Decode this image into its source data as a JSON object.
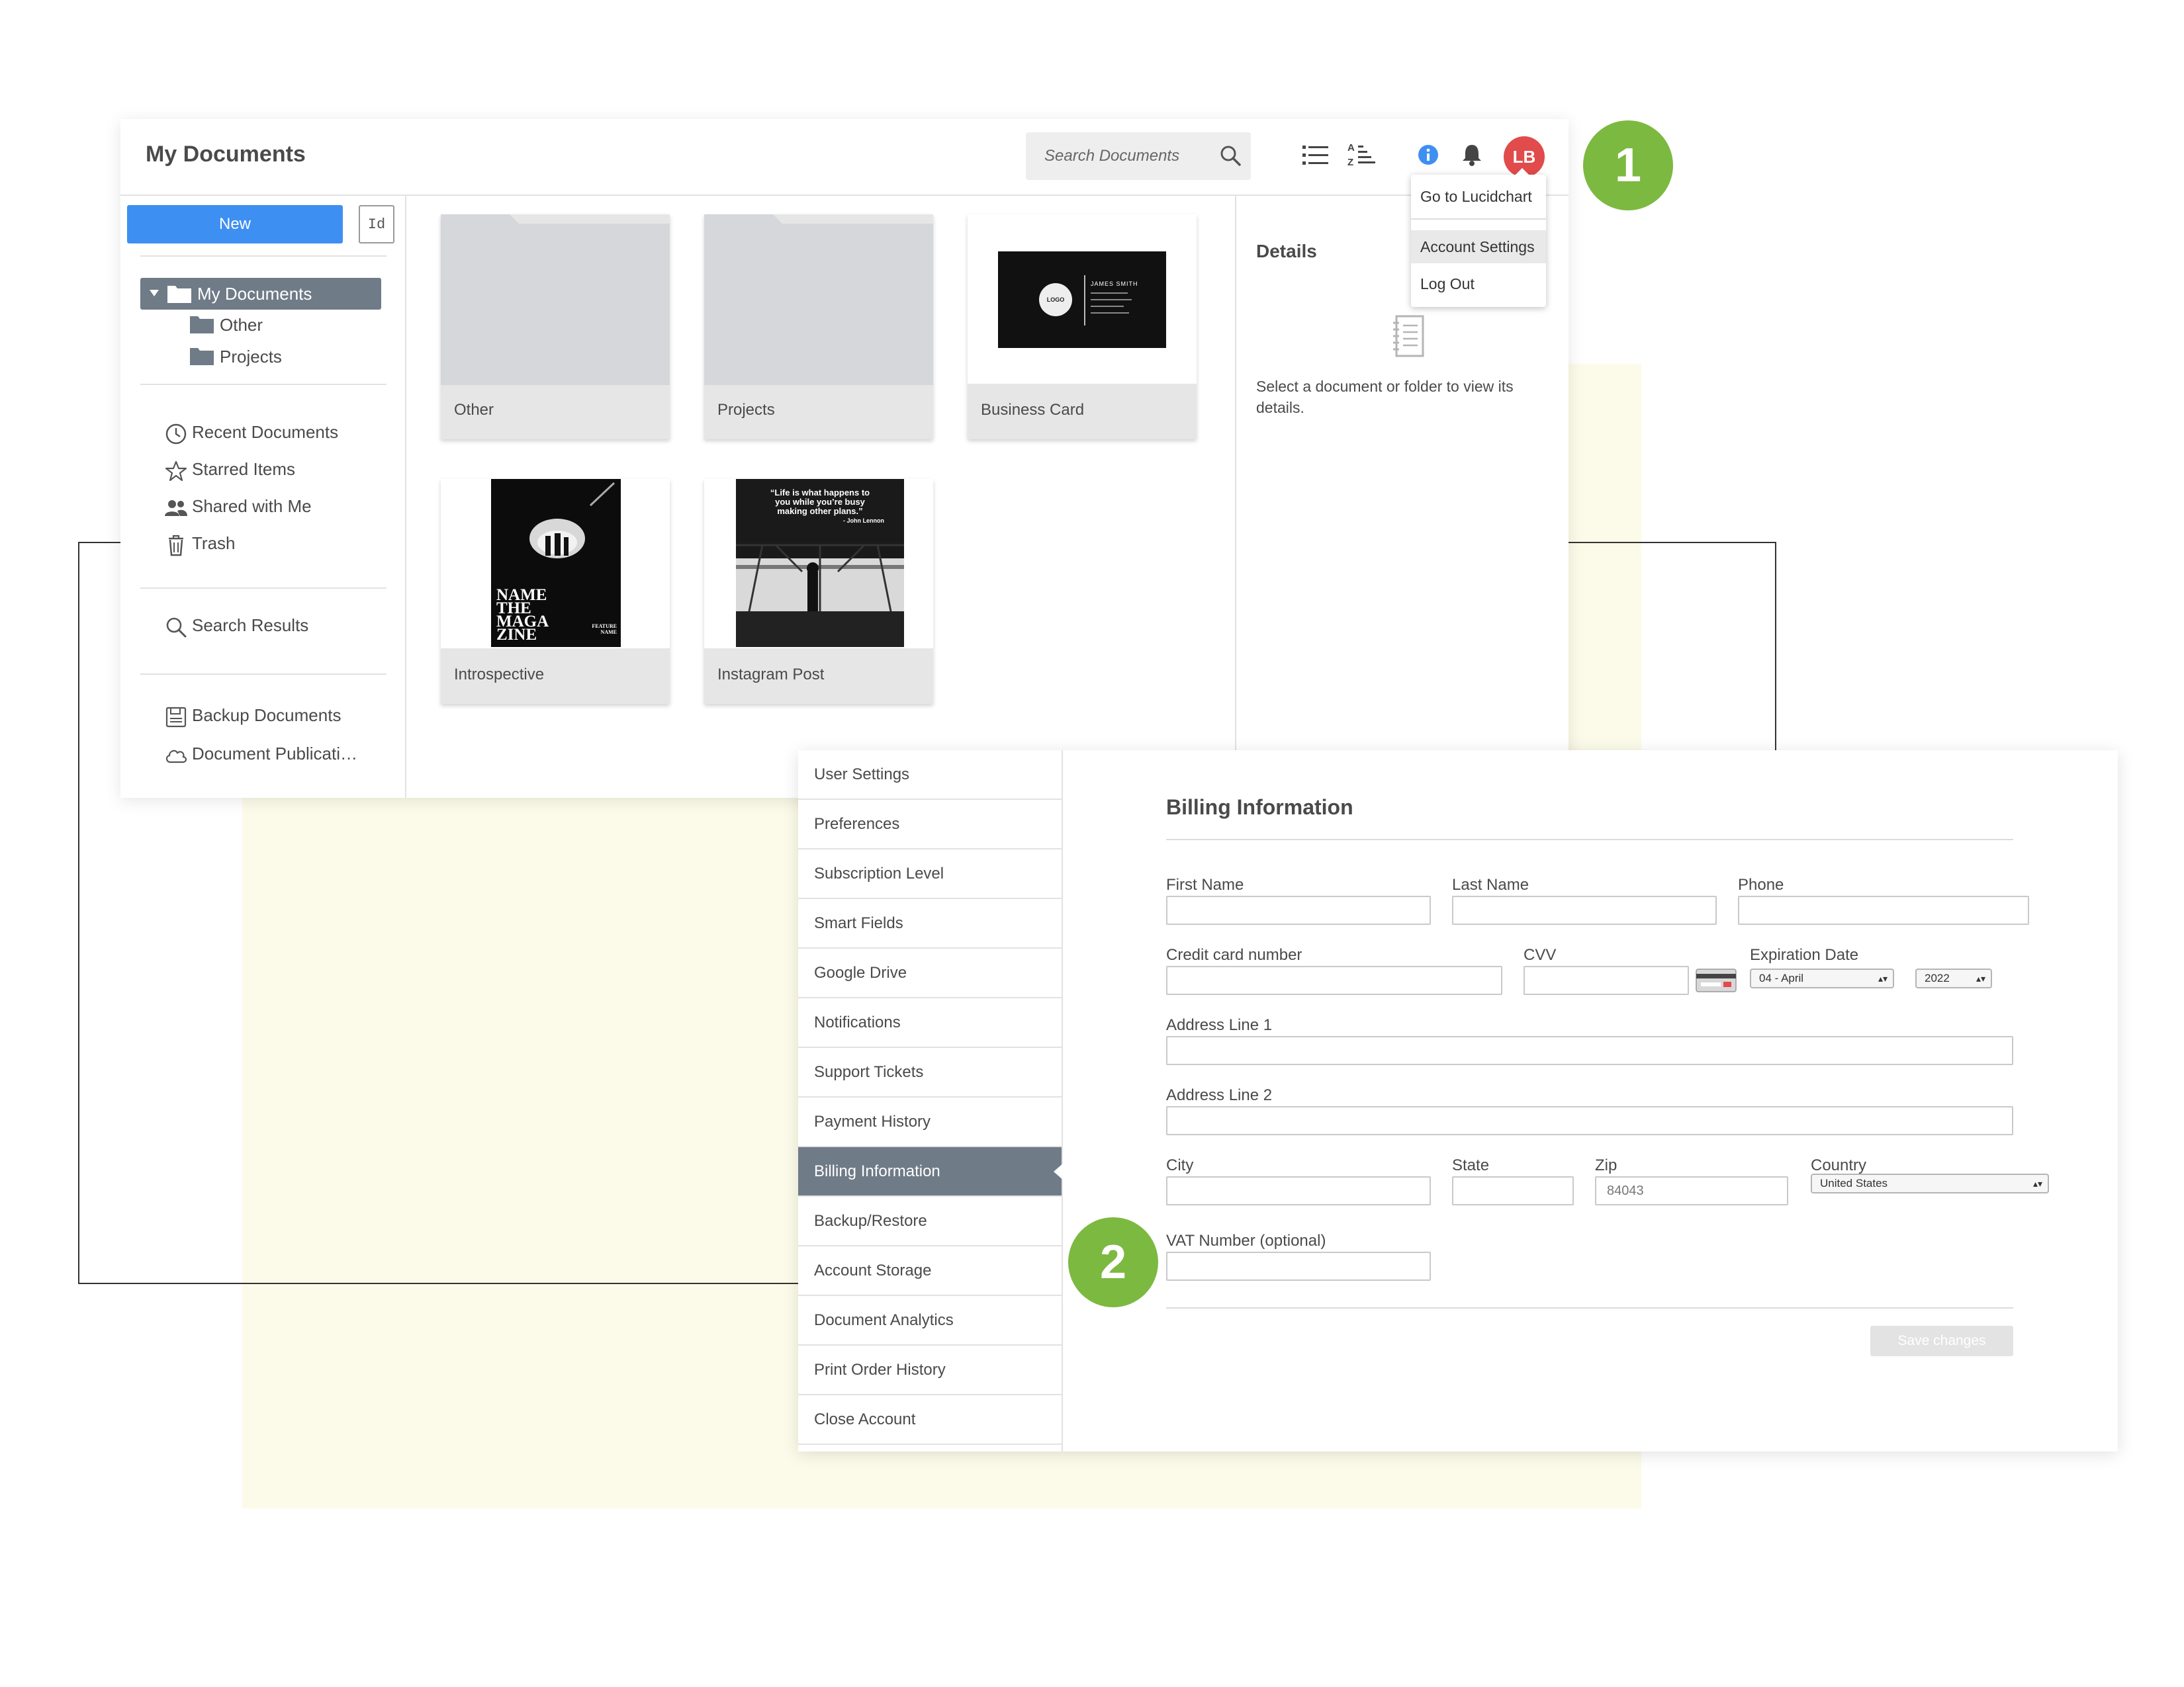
{
  "colors": {
    "accent": "#3e8ff2",
    "selected": "#6f7b87",
    "badge": "#7cb940",
    "avatar": "#e14b4b",
    "info": "#3e8ff2",
    "background_panel": "#fcfbe9"
  },
  "badges": [
    "1",
    "2"
  ],
  "documents_window": {
    "title": "My Documents",
    "search": {
      "placeholder": "Search Documents",
      "icon": "search-icon"
    },
    "header_icons": [
      "list-view-icon",
      "sort-az-icon",
      "info-icon",
      "bell-icon"
    ],
    "avatar_initials": "LB",
    "account_menu": {
      "items": [
        "Go to Lucidchart",
        "Account Settings",
        "Log Out"
      ],
      "active": "Account Settings"
    },
    "sidebar": {
      "new_label": "New",
      "id_label": "Id",
      "tree": {
        "root": "My Documents",
        "children": [
          "Other",
          "Projects"
        ]
      },
      "nav": [
        {
          "label": "Recent Documents",
          "icon": "clock-icon"
        },
        {
          "label": "Starred Items",
          "icon": "star-icon"
        },
        {
          "label": "Shared with Me",
          "icon": "people-icon"
        },
        {
          "label": "Trash",
          "icon": "trash-icon"
        }
      ],
      "search_results": {
        "label": "Search Results",
        "icon": "search-icon"
      },
      "storage": [
        {
          "label": "Backup Documents",
          "icon": "save-icon"
        },
        {
          "label": "Document Publicati…",
          "icon": "cloud-icon"
        }
      ]
    },
    "items": [
      {
        "label": "Other",
        "kind": "folder"
      },
      {
        "label": "Projects",
        "kind": "folder"
      },
      {
        "label": "Business Card",
        "kind": "document",
        "thumb_text": [
          "LOGO",
          "JAMES SMITH"
        ]
      },
      {
        "label": "Introspective",
        "kind": "document",
        "thumb_text": [
          "NAME",
          "THE",
          "MAGA",
          "ZINE",
          "FEATURE",
          "NAME"
        ]
      },
      {
        "label": "Instagram Post",
        "kind": "document",
        "thumb_text": [
          "“Life is what happens to",
          "you while you’re busy",
          "making other plans.”",
          "- John Lennon"
        ]
      }
    ],
    "details": {
      "title": "Details",
      "message": "Select a document or folder to view its details.",
      "icon": "notebook-icon"
    }
  },
  "settings_window": {
    "menu": [
      "User Settings",
      "Preferences",
      "Subscription Level",
      "Smart Fields",
      "Google Drive",
      "Notifications",
      "Support Tickets",
      "Payment History",
      "Billing Information",
      "Backup/Restore",
      "Account Storage",
      "Document Analytics",
      "Print Order History",
      "Close Account"
    ],
    "active_menu": "Billing Information",
    "form": {
      "title": "Billing Information",
      "labels": {
        "first_name": "First Name",
        "last_name": "Last Name",
        "phone": "Phone",
        "card_number": "Credit card number",
        "cvv": "CVV",
        "expiration": "Expiration Date",
        "address1": "Address Line 1",
        "address2": "Address Line 2",
        "city": "City",
        "state": "State",
        "zip": "Zip",
        "country": "Country",
        "vat": "VAT Number (optional)"
      },
      "values": {
        "expiration_month": "04 - April",
        "expiration_year": "2022",
        "zip": "84043",
        "country": "United States"
      },
      "card_icon": "credit-card-icon",
      "save_label": "Save changes"
    }
  }
}
